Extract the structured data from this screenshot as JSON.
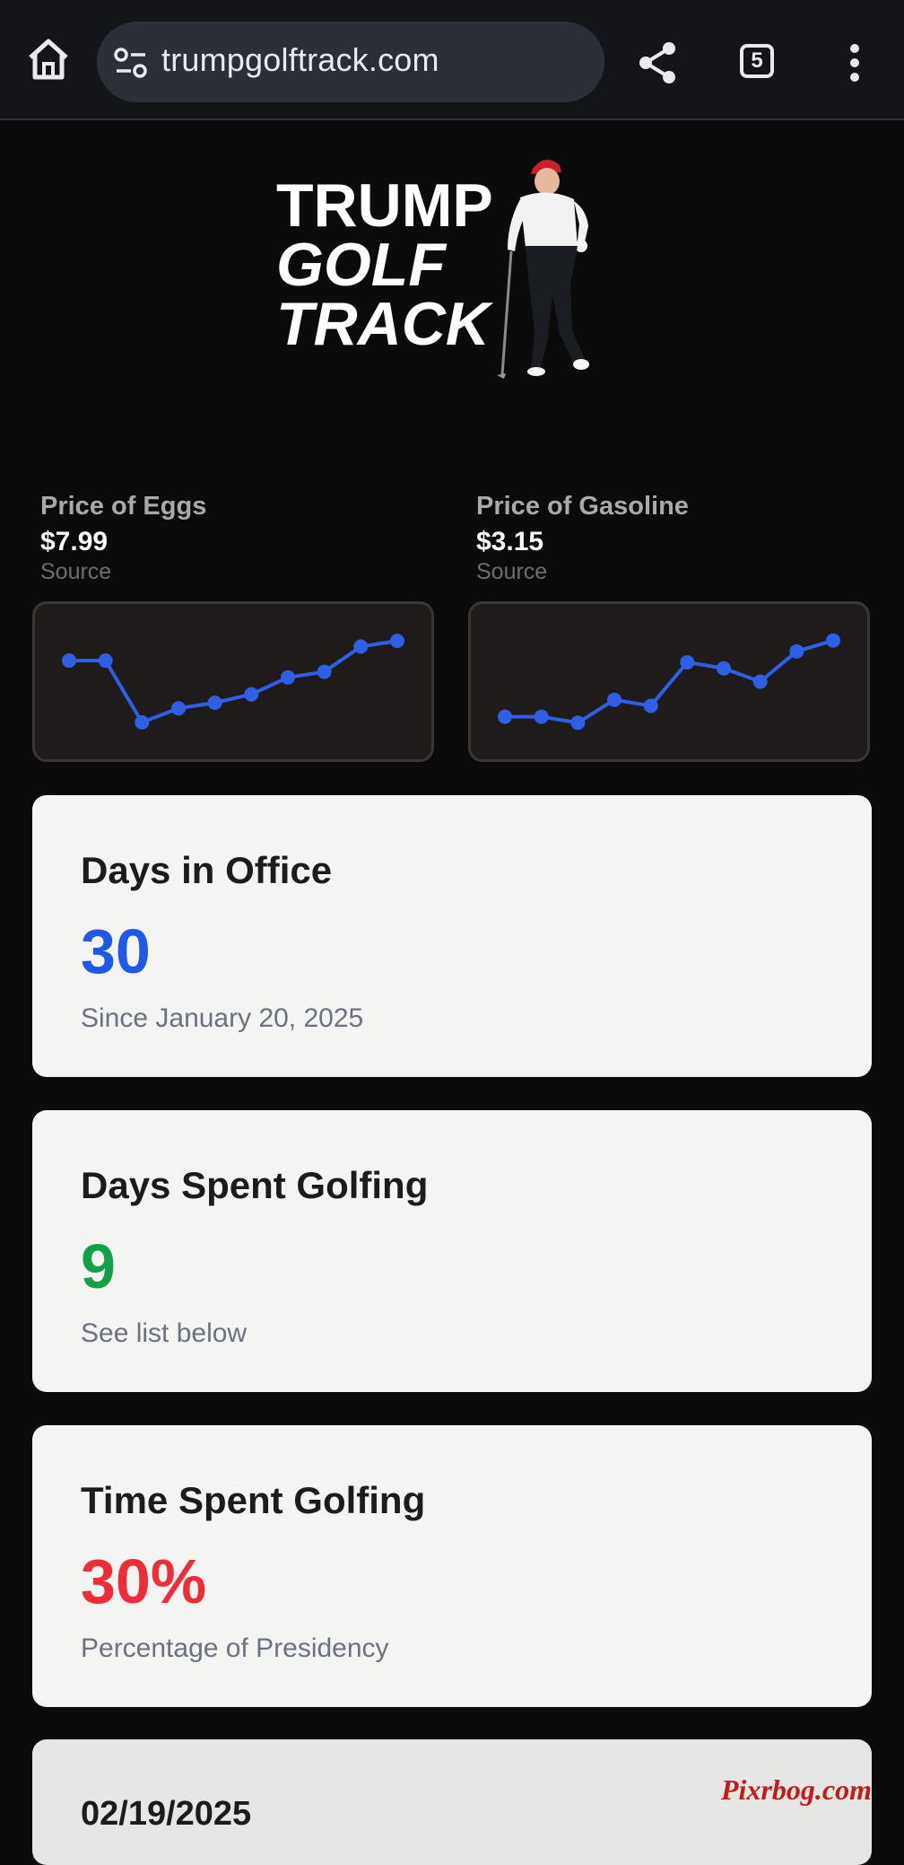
{
  "browser": {
    "url": "trumpgolftrack.com",
    "tab_count": "5",
    "icons": [
      "home-icon",
      "site-info-icon",
      "share-icon",
      "tab-switcher-icon",
      "more-menu-icon"
    ]
  },
  "hero": {
    "title_line1": "TRUMP",
    "title_line2": "GOLF",
    "title_line3": "TRACK"
  },
  "prices": [
    {
      "name": "Price of Eggs",
      "value": "$7.99",
      "source": "Source"
    },
    {
      "name": "Price of Gasoline",
      "value": "$3.15",
      "source": "Source"
    }
  ],
  "chart_data": [
    {
      "type": "line",
      "x": [
        1,
        2,
        3,
        4,
        5,
        6,
        7,
        8,
        9,
        10
      ],
      "series": [
        {
          "values": [
            6.3,
            6.3,
            4.1,
            4.6,
            4.8,
            5.1,
            5.7,
            5.9,
            6.8,
            7.0
          ]
        }
      ],
      "ylim": [
        4.0,
        7.1
      ],
      "color": "#2f5fe6",
      "grid": false
    },
    {
      "type": "line",
      "x": [
        1,
        2,
        3,
        4,
        5,
        6,
        7,
        8,
        9,
        10
      ],
      "series": [
        {
          "values": [
            2.75,
            2.75,
            2.7,
            2.89,
            2.84,
            3.2,
            3.15,
            3.04,
            3.29,
            3.38
          ]
        }
      ],
      "ylim": [
        2.68,
        3.4
      ],
      "color": "#2f5fe6",
      "grid": false
    }
  ],
  "stats": [
    {
      "title": "Days in Office",
      "value": "30",
      "subtitle": "Since January 20, 2025",
      "color": "#1f5ae6"
    },
    {
      "title": "Days Spent Golfing",
      "value": "9",
      "subtitle": "See list below",
      "color": "#14a046"
    },
    {
      "title": "Time Spent Golfing",
      "value": "30%",
      "subtitle": "Percentage of Presidency",
      "color": "#ef2d38"
    }
  ],
  "golf_days": [
    {
      "date": "02/19/2025"
    }
  ],
  "watermark": "Pixrbog.com"
}
